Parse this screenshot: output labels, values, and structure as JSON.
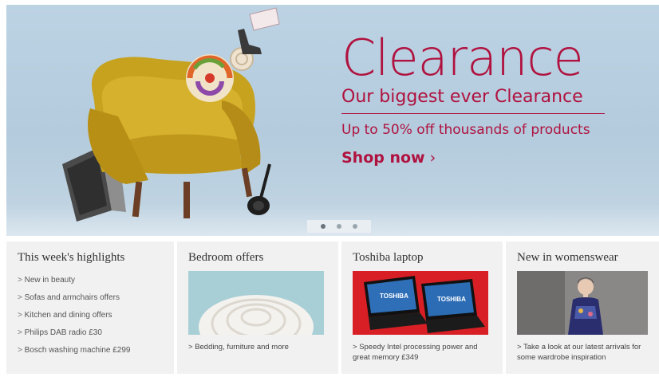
{
  "hero": {
    "title": "Clearance",
    "subtitle": "Our biggest ever Clearance",
    "offer": "Up to 50% off thousands of products",
    "cta": "Shop now",
    "cta_chevron": "›",
    "slides": 3,
    "active_slide": 1,
    "accent_color": "#b0123f"
  },
  "highlights": {
    "title": "This week's highlights",
    "items": [
      "New in beauty",
      "Sofas and armchairs offers",
      "Kitchen and dining offers",
      "Philips DAB radio £30",
      "Bosch washing machine £299"
    ]
  },
  "tiles": [
    {
      "title": "Bedroom offers",
      "link": "Bedding, furniture and more",
      "image": "duvet-image"
    },
    {
      "title": "Toshiba laptop",
      "link": "Speedy Intel processing power and great memory £349",
      "image": "laptop-image",
      "brand": "TOSHIBA"
    },
    {
      "title": "New in womenswear",
      "link": "Take a look at our latest arrivals for some wardrobe inspiration",
      "image": "womenswear-image"
    }
  ]
}
